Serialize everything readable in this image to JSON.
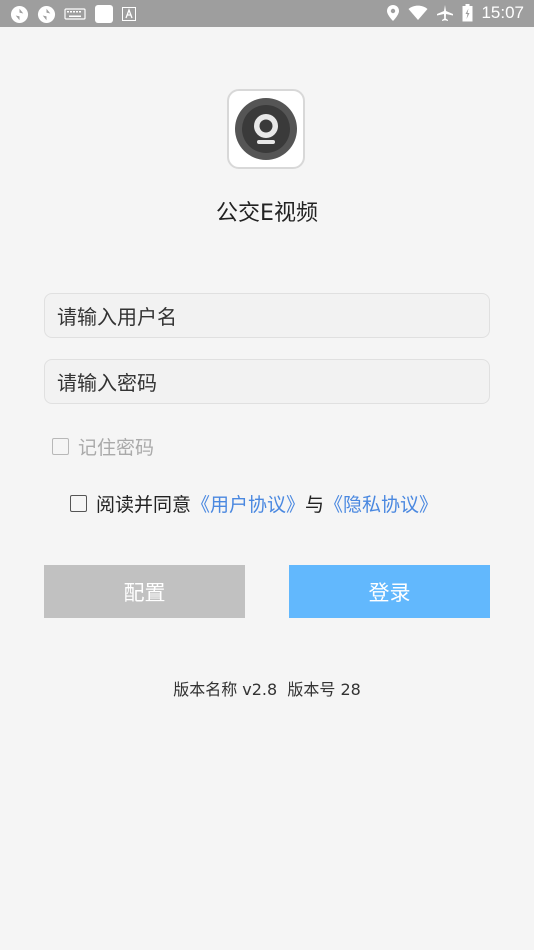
{
  "status_bar": {
    "time": "15:07",
    "left_icons": [
      "sync-icon",
      "sync-icon",
      "keyboard-icon",
      "square-app-icon",
      "font-icon"
    ],
    "right_icons": [
      "location-icon",
      "wifi-icon",
      "airplane-icon",
      "battery-icon"
    ]
  },
  "app": {
    "name": "公交E视频",
    "logo_icon": "camera-icon"
  },
  "form": {
    "username_placeholder": "请输入用户名",
    "password_placeholder": "请输入密码",
    "remember_label": "记住密码",
    "agree_text": "阅读并同意",
    "user_agreement": "《用户协议》",
    "and_text": "与",
    "privacy_policy": "《隐私协议》"
  },
  "buttons": {
    "config": "配置",
    "login": "登录"
  },
  "footer": {
    "version": "版本名称 v2.8  版本号 28"
  },
  "colors": {
    "status_bar": "#9e9e9e",
    "login_button": "#62b8fd",
    "config_button": "#c1c1c1",
    "link": "#4a88e0"
  }
}
